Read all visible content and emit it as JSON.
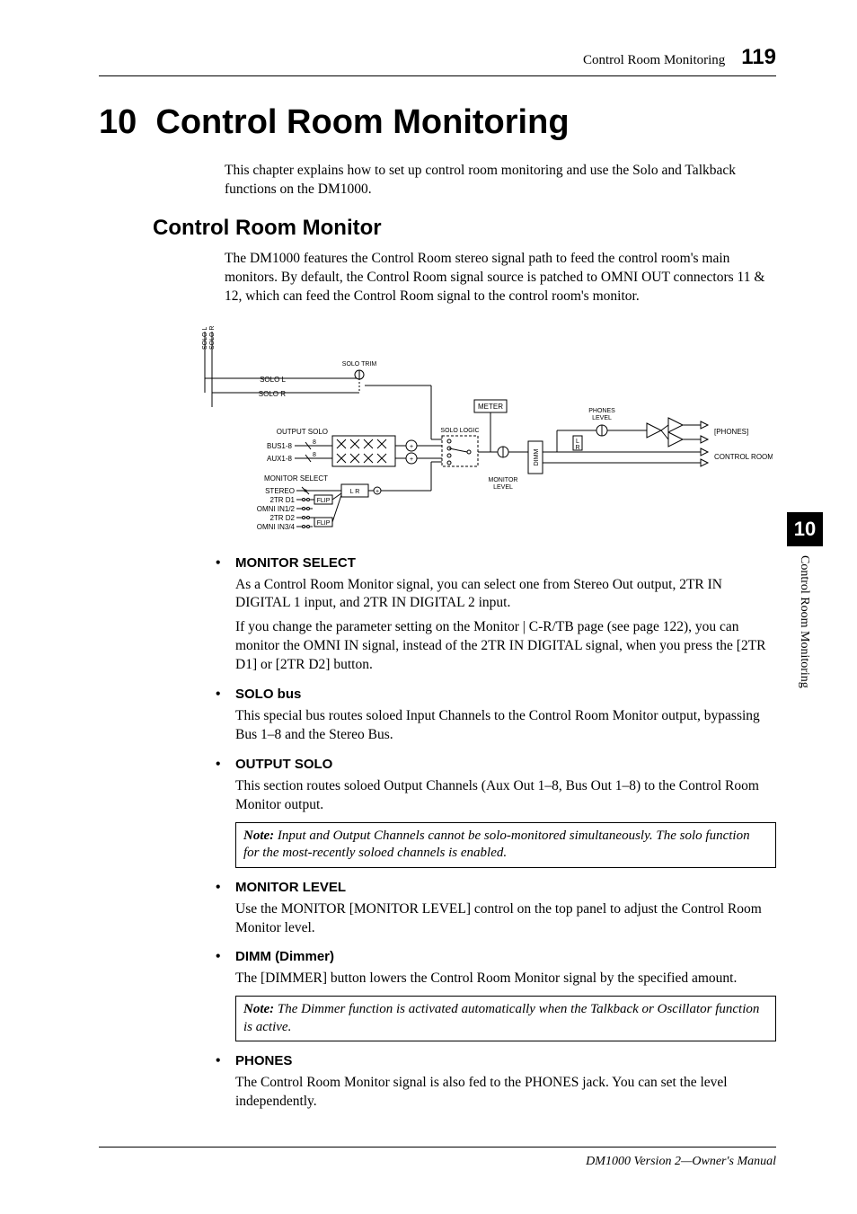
{
  "header": {
    "running_title": "Control Room Monitoring",
    "page_number": "119"
  },
  "chapter": {
    "number": "10",
    "title": "Control Room Monitoring"
  },
  "intro": "This chapter explains how to set up control room monitoring and use the Solo and Talkback functions on the DM1000.",
  "section": {
    "title": "Control Room Monitor",
    "intro": "The DM1000 features the Control Room stereo signal path to feed the control room's main monitors. By default, the Control Room signal source is patched to OMNI OUT connectors 11 & 12, which can feed the Control Room signal to the control room's monitor."
  },
  "diagram": {
    "left_labels": {
      "solo_l_out": "SOLO L",
      "solo_r_out": "SOLO R"
    },
    "solo_trim": "SOLO TRIM",
    "solo_l": "SOLO L",
    "solo_r": "SOLO R",
    "output_solo": "OUTPUT SOLO",
    "bus": "BUS1-8",
    "aux": "AUX1-8",
    "monitor_select": "MONITOR SELECT",
    "stereo": "STEREO",
    "2trd1": "2TR D1",
    "omni12": "OMNI IN1/2",
    "2trd2": "2TR D2",
    "omni34": "OMNI IN3/4",
    "flip1": "FLIP",
    "flip2": "FLIP",
    "lr": "L R",
    "solo_logic": "SOLO LOGIC",
    "meter": "METER",
    "monitor_level": "MONITOR\nLEVEL",
    "dimm": "DIMM",
    "phones_level": "PHONES\nLEVEL",
    "phones_out": "[PHONES]",
    "cr_out": "CONTROL ROOM"
  },
  "bullets": [
    {
      "head": "MONITOR SELECT",
      "paras": [
        "As a Control Room Monitor signal, you can select one from Stereo Out output, 2TR IN DIGITAL 1 input, and 2TR IN DIGITAL 2 input.",
        "If you change the parameter setting on the Monitor | C-R/TB page (see page 122), you can monitor the OMNI IN signal, instead of the 2TR IN DIGITAL signal, when you press the [2TR D1] or [2TR D2] button."
      ]
    },
    {
      "head": "SOLO bus",
      "paras": [
        "This special bus routes soloed Input Channels to the Control Room Monitor output, bypassing Bus 1–8 and the Stereo Bus."
      ]
    },
    {
      "head": "OUTPUT SOLO",
      "paras": [
        "This section routes soloed Output Channels (Aux Out 1–8, Bus Out 1–8) to the Control Room Monitor output."
      ],
      "note": "Input and Output Channels cannot be solo-monitored simultaneously. The solo function for the most-recently soloed channels is enabled."
    },
    {
      "head": "MONITOR LEVEL",
      "paras": [
        "Use the MONITOR [MONITOR LEVEL] control on the top panel to adjust the Control Room Monitor level."
      ]
    },
    {
      "head": "DIMM (Dimmer)",
      "paras": [
        "The [DIMMER] button lowers the Control Room Monitor signal by the specified amount."
      ],
      "note": "The Dimmer function is activated automatically when the Talkback or Oscillator function is active."
    },
    {
      "head": "PHONES",
      "paras": [
        "The Control Room Monitor signal is also fed to the PHONES jack. You can set the level independently."
      ]
    }
  ],
  "note_label": "Note:  ",
  "footer": "DM1000 Version 2—Owner's Manual",
  "side_tab": {
    "number": "10",
    "label": "Control Room Monitoring"
  }
}
